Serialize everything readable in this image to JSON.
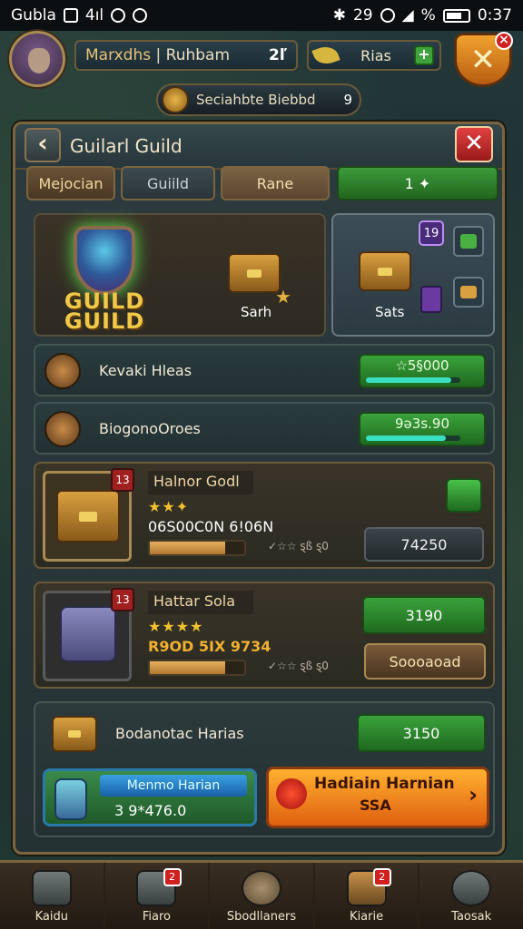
{
  "status_bar": {
    "carrier": "Gubla",
    "signal": "4ıl",
    "time_left": "29",
    "battery": "%",
    "time": "0:37"
  },
  "player": {
    "name": "Marxdhs",
    "clan": "Ruhbam",
    "level": "2ľ"
  },
  "currency": {
    "label": "Rias"
  },
  "event": {
    "label": "Seciahbte Biebbd",
    "count": "9"
  },
  "panel": {
    "title": "Guilarl Guild"
  },
  "tabs": [
    "Mejocian",
    "Guiild",
    "Rane",
    "1 ✦"
  ],
  "rewards": {
    "emblem_text": "GUILD GUILD",
    "item1_label": "Sarh",
    "item2_label": "Sats",
    "badge": "19"
  },
  "rows": [
    {
      "label": "Kevaki Hleas",
      "value": "☆5§000"
    },
    {
      "label": "BiogonoOroes",
      "value": "9ǝ3s.90"
    }
  ],
  "cards": [
    {
      "count": "13",
      "name": "Halnor Godl",
      "stars": "★★✦",
      "line": "06S00C0N 6!06N",
      "progress_text": "✓☆☆ ȿß ȿ0",
      "progress": 0.8,
      "button": "74250"
    },
    {
      "count": "13",
      "name": "Hattar Sola",
      "stars": "★★★★",
      "line": "R9OD 5IX 9734",
      "progress_text": "✓☆☆ ȿß ȿ0",
      "progress": 0.8,
      "button1": "3190",
      "button2": "Soooaoad"
    }
  ],
  "bottom_row": {
    "label": "Bodanotac Harias",
    "value": "3150"
  },
  "blue_button": {
    "label": "Menmo Harian",
    "value": "3 9*476.0"
  },
  "orange_button": {
    "label": "Hadiain Harnian",
    "value": "SSA"
  },
  "nav": [
    {
      "label": "Kaidu"
    },
    {
      "label": "Fiaro",
      "badge": "2"
    },
    {
      "label": "Sbodllaners"
    },
    {
      "label": "Kiarie",
      "badge": "2"
    },
    {
      "label": "Taosak"
    }
  ]
}
